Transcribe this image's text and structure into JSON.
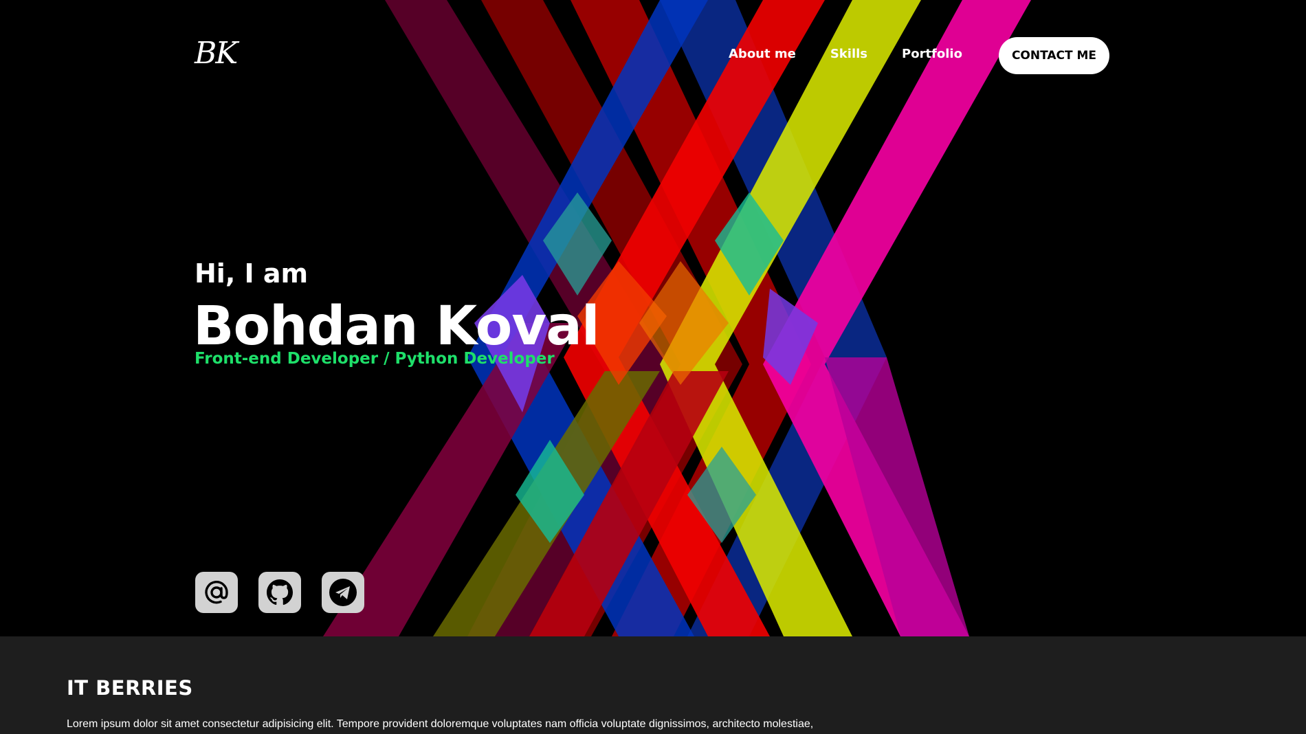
{
  "header": {
    "logo": "BK",
    "nav": [
      "About me",
      "Skills",
      "Portfolio"
    ],
    "contact_button": "CONTACT ME"
  },
  "hero": {
    "greeting": "Hi, I am",
    "name": "Bohdan Koval",
    "role": "Front-end Developer / Python Developer",
    "role_color": "#1ee06a",
    "socials": [
      {
        "icon": "at-sign-icon"
      },
      {
        "icon": "github-icon"
      },
      {
        "icon": "telegram-icon"
      }
    ]
  },
  "section": {
    "title": "IT BERRIES",
    "text": "Lorem ipsum dolor sit amet consectetur adipisicing elit. Tempore provident doloremque voluptates nam officia voluptate dignissimos, architecto molestiae,"
  },
  "colors": {
    "background": "#000000",
    "section_background": "#1e1e1e",
    "accent_green": "#1ee06a",
    "button_background": "#ffffff"
  }
}
